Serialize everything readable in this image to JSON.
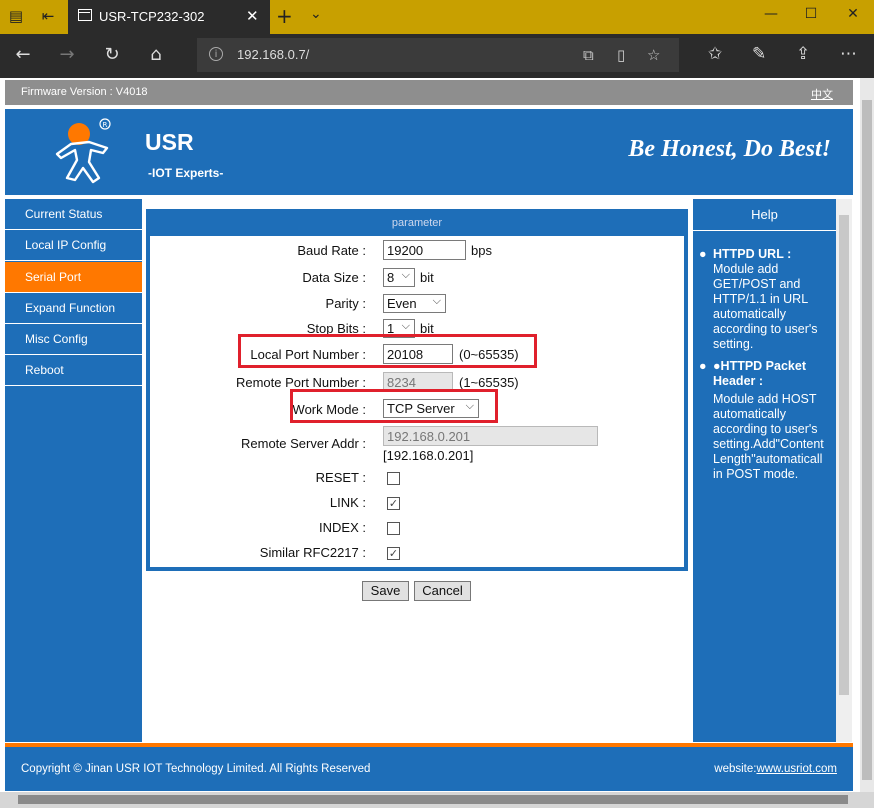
{
  "browser": {
    "tab_title": "USR-TCP232-302",
    "url": "192.168.0.7/"
  },
  "page": {
    "firmware": "Firmware Version : V4018",
    "language_link": "中文",
    "brand": "USR",
    "brand_sub": "-IOT Experts-",
    "slogan": "Be Honest, Do Best!",
    "sidebar": [
      {
        "label": "Current Status",
        "active": false
      },
      {
        "label": "Local IP Config",
        "active": false
      },
      {
        "label": "Serial Port",
        "active": true
      },
      {
        "label": "Expand Function",
        "active": false
      },
      {
        "label": "Misc Config",
        "active": false
      },
      {
        "label": "Reboot",
        "active": false
      }
    ],
    "panel_title": "parameter",
    "form": {
      "baud_rate": {
        "label": "Baud Rate :",
        "value": "19200",
        "unit": "bps"
      },
      "data_size": {
        "label": "Data Size :",
        "value": "8",
        "unit": "bit"
      },
      "parity": {
        "label": "Parity :",
        "value": "Even"
      },
      "stop_bits": {
        "label": "Stop Bits :",
        "value": "1",
        "unit": "bit"
      },
      "local_port": {
        "label": "Local Port Number :",
        "value": "20108",
        "range": "(0~65535)"
      },
      "remote_port": {
        "label": "Remote Port Number :",
        "value": "8234",
        "range": "(1~65535)"
      },
      "work_mode": {
        "label": "Work Mode :",
        "value": "TCP Server"
      },
      "remote_server": {
        "label": "Remote Server Addr :",
        "value": "192.168.0.201",
        "note": "[192.168.0.201]"
      },
      "reset": {
        "label": "RESET :",
        "checked": false
      },
      "link": {
        "label": "LINK :",
        "checked": true
      },
      "index": {
        "label": "INDEX :",
        "checked": false
      },
      "rfc2217": {
        "label": "Similar RFC2217 :",
        "checked": true
      }
    },
    "save_label": "Save",
    "cancel_label": "Cancel",
    "help": {
      "title": "Help",
      "sections": [
        {
          "bullet": "●",
          "heading": "HTTPD URL :",
          "lines": [
            "Module add",
            "GET/POST and",
            "HTTP/1.1 in URL",
            "automatically",
            "according to user's",
            "setting."
          ]
        },
        {
          "bullet": "●",
          "heading_lines": [
            "●HTTPD Packet",
            "Header :"
          ],
          "lines": [
            "Module add HOST",
            "automatically",
            "according to user's",
            "setting.Add\"Content",
            "Length\"automaticall",
            "in POST mode."
          ]
        }
      ]
    },
    "footer": {
      "copyright": "Copyright © Jinan USR IOT Technology Limited. All Rights Reserved",
      "website_label": "website:",
      "website_link": "www.usriot.com"
    }
  }
}
